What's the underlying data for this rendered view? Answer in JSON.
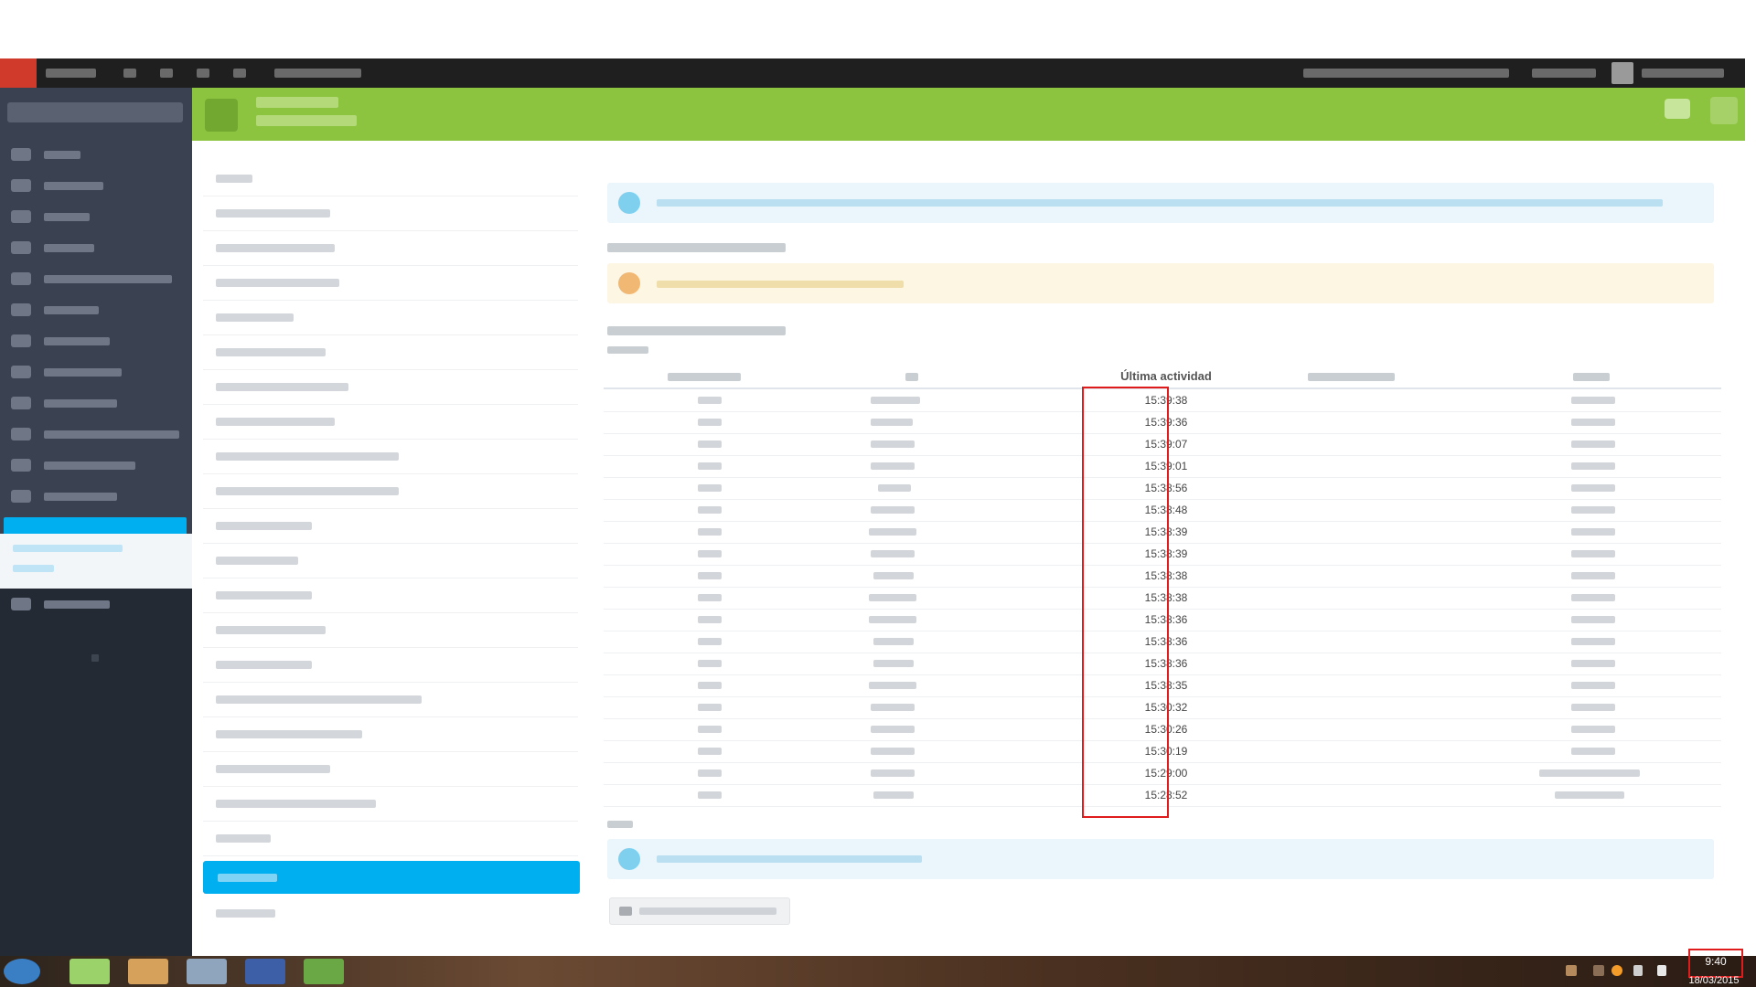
{
  "table": {
    "column_header": "Última actividad",
    "times": [
      "15:39:38",
      "15:39:36",
      "15:39:07",
      "15:39:01",
      "15:38:56",
      "15:38:48",
      "15:38:39",
      "15:38:39",
      "15:38:38",
      "15:38:38",
      "15:38:36",
      "15:38:36",
      "15:38:36",
      "15:38:35",
      "15:30:32",
      "15:30:26",
      "15:30:19",
      "15:29:00",
      "15:28:52"
    ]
  },
  "taskbar": {
    "time": "9:40",
    "date": "18/03/2015"
  },
  "colors": {
    "header_green": "#8dc43f",
    "accent_blue": "#00aff0",
    "highlight_red": "#e01b1b"
  }
}
